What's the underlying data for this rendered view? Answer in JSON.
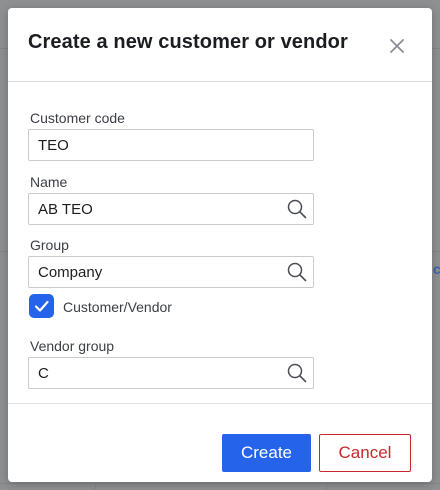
{
  "dialog": {
    "title": "Create a new customer or vendor",
    "close_icon": "close-icon"
  },
  "form": {
    "customer_code": {
      "label": "Customer code",
      "value": "TEO"
    },
    "name": {
      "label": "Name",
      "value": "AB TEO",
      "icon": "search-icon"
    },
    "group": {
      "label": "Group",
      "value": "Company",
      "icon": "search-icon"
    },
    "customer_vendor": {
      "label": "Customer/Vendor",
      "checked": true
    },
    "vendor_group": {
      "label": "Vendor group",
      "value": "C",
      "icon": "search-icon"
    }
  },
  "footer": {
    "create_label": "Create",
    "cancel_label": "Cancel"
  },
  "colors": {
    "primary": "#2563eb",
    "danger": "#c8282d",
    "text": "#1c1d21",
    "overlay": "#8f9092"
  }
}
